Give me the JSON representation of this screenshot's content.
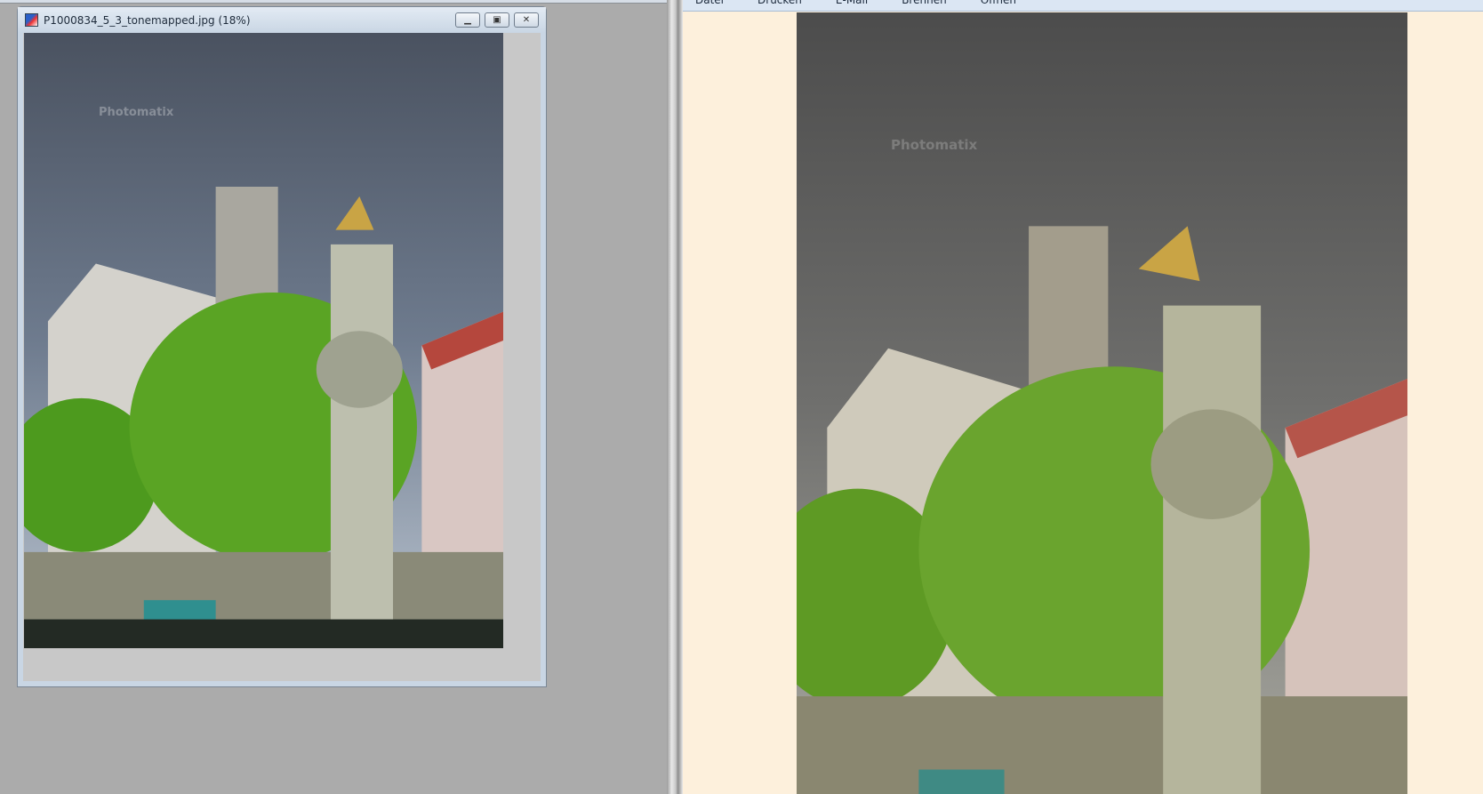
{
  "image_window": {
    "title": "P1000834_5_3_tonemapped.jpg (18%)",
    "minimize_icon": "minimize-icon",
    "maximize_icon": "restore-icon",
    "close_icon": "close-icon",
    "watermark": "Photomatix"
  },
  "viewer": {
    "menu": [
      "Datei",
      "Drucken",
      "E-Mail",
      "Brennen",
      "Öffnen"
    ],
    "watermark": "Photomatix"
  },
  "colors": {
    "left_bg": "#ababab",
    "viewer_bg": "#fdf0dc",
    "menubar": "#dbe6f3"
  }
}
